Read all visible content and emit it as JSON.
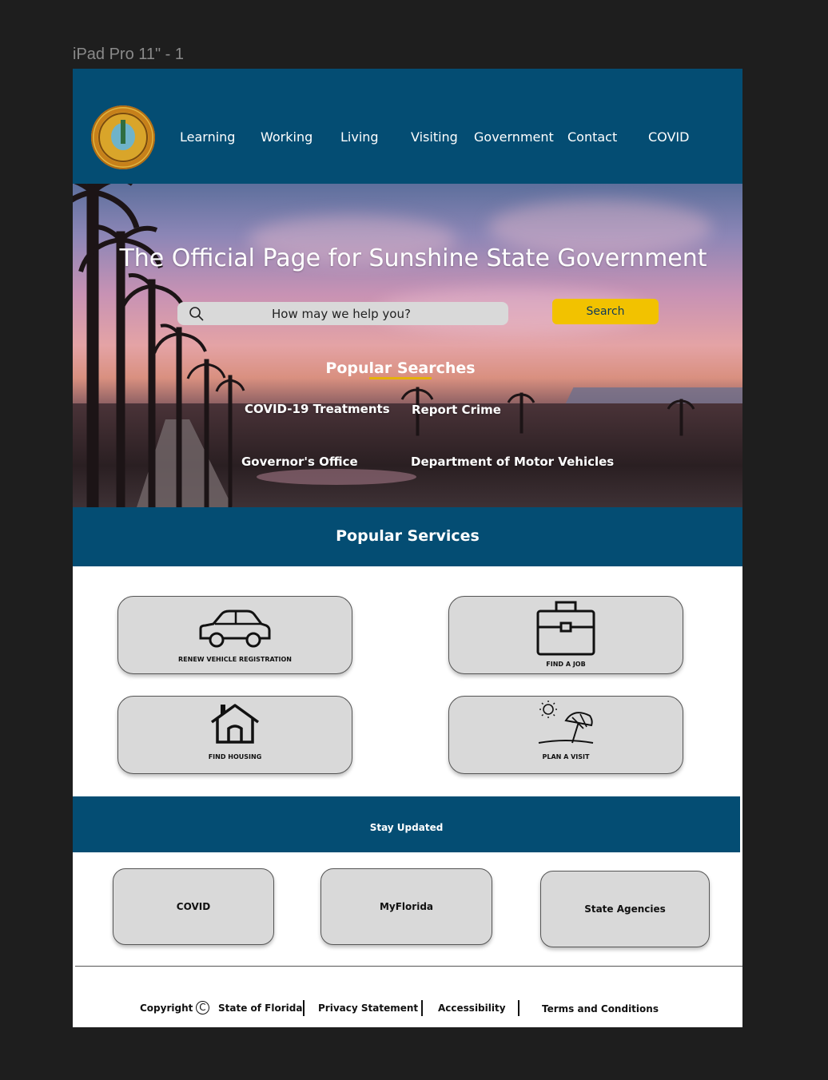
{
  "frame_label": "iPad Pro 11\" - 1",
  "header": {
    "nav": [
      "Learning",
      "Working",
      "Living",
      "Visiting",
      "Government",
      "Contact",
      "COVID"
    ]
  },
  "hero": {
    "title": "The Official Page for Sunshine State Government",
    "search_placeholder": "How may we help you?",
    "search_button": "Search",
    "popular_searches_title": "Popular Searches",
    "popular_searches": [
      "COVID-19 Treatments",
      "Report Crime",
      "Governor's Office",
      "Department of Motor Vehicles"
    ]
  },
  "services": {
    "title": "Popular Services",
    "items": [
      {
        "label": "RENEW VEHICLE REGISTRATION",
        "icon": "car-icon"
      },
      {
        "label": "FIND A JOB",
        "icon": "briefcase-icon"
      },
      {
        "label": "FIND HOUSING",
        "icon": "house-icon"
      },
      {
        "label": "PLAN A VISIT",
        "icon": "beach-umbrella-icon"
      }
    ]
  },
  "updates": {
    "title": "Stay Updated",
    "items": [
      "COVID",
      "MyFlorida",
      "State Agencies"
    ]
  },
  "footer": {
    "copyright": "Copyright",
    "copyright_symbol": "C",
    "owner": "State of Florida",
    "links": [
      "Privacy Statement",
      "Accessibility",
      "Terms and Conditions"
    ]
  },
  "colors": {
    "brand_blue": "#044d73",
    "accent_yellow": "#f2c200",
    "card_gray": "#d9d9d9"
  }
}
